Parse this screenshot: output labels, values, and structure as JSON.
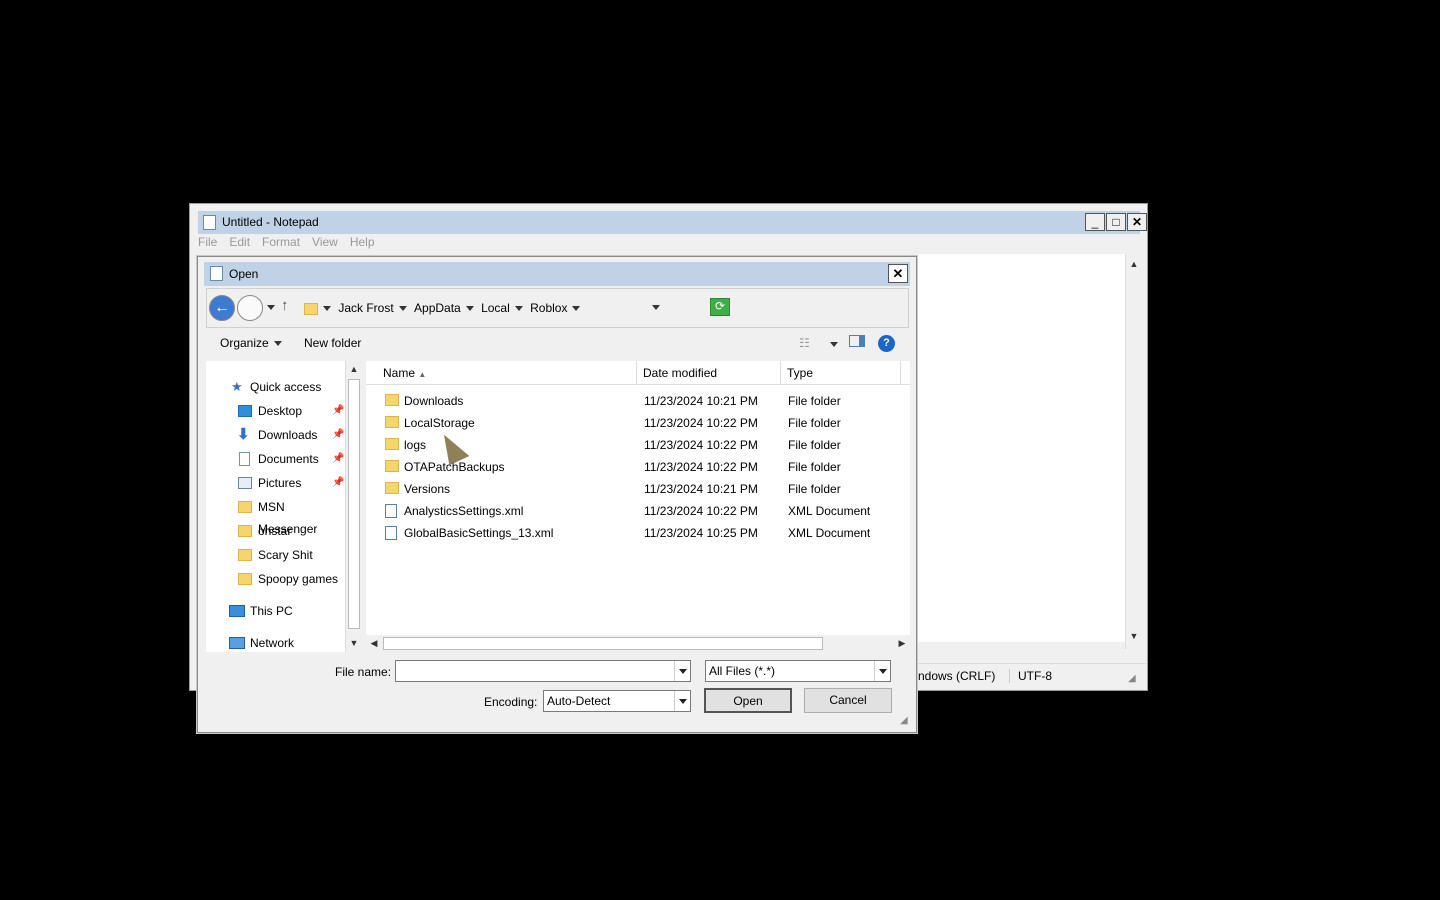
{
  "notepad": {
    "title": "Untitled - Notepad",
    "menu": [
      "File",
      "Edit",
      "Format",
      "View",
      "Help"
    ],
    "status_line_ending": "Windows (CRLF)",
    "status_encoding": "UTF-8"
  },
  "dialog": {
    "title": "Open",
    "breadcrumb": [
      "Jack Frost",
      "AppData",
      "Local",
      "Roblox"
    ],
    "toolbar": {
      "organize": "Organize",
      "new_folder": "New folder"
    },
    "nav": {
      "quick_access": "Quick access",
      "items": [
        {
          "label": "Desktop",
          "pinned": true
        },
        {
          "label": "Downloads",
          "pinned": true
        },
        {
          "label": "Documents",
          "pinned": true
        },
        {
          "label": "Pictures",
          "pinned": true
        },
        {
          "label": "MSN Messenger",
          "pinned": false
        },
        {
          "label": "onstar",
          "pinned": false
        },
        {
          "label": "Scary Shit",
          "pinned": false
        },
        {
          "label": "Spoopy games",
          "pinned": false
        }
      ],
      "this_pc": "This PC",
      "network": "Network"
    },
    "columns": {
      "name": "Name",
      "date": "Date modified",
      "type": "Type"
    },
    "files": [
      {
        "name": "Downloads",
        "date": "11/23/2024 10:21 PM",
        "type": "File folder",
        "icon": "folder-icon"
      },
      {
        "name": "LocalStorage",
        "date": "11/23/2024 10:22 PM",
        "type": "File folder",
        "icon": "folder-icon"
      },
      {
        "name": "logs",
        "date": "11/23/2024 10:22 PM",
        "type": "File folder",
        "icon": "folder-icon"
      },
      {
        "name": "OTAPatchBackups",
        "date": "11/23/2024 10:22 PM",
        "type": "File folder",
        "icon": "folder-icon"
      },
      {
        "name": "Versions",
        "date": "11/23/2024 10:21 PM",
        "type": "File folder",
        "icon": "folder-icon"
      },
      {
        "name": "AnalysticsSettings.xml",
        "date": "11/23/2024 10:22 PM",
        "type": "XML Document",
        "icon": "xml-file-icon"
      },
      {
        "name": "GlobalBasicSettings_13.xml",
        "date": "11/23/2024 10:25 PM",
        "type": "XML Document",
        "icon": "xml-file-icon"
      }
    ],
    "file_name_label": "File name:",
    "file_name_value": "",
    "filter_value": "All Files  (*.*)",
    "encoding_label": "Encoding:",
    "encoding_value": "Auto-Detect",
    "open_button": "Open",
    "cancel_button": "Cancel"
  },
  "colors": {
    "title_bar": "#bfd2e6",
    "accent": "#1b66c9",
    "folder": "#f6d66c"
  }
}
